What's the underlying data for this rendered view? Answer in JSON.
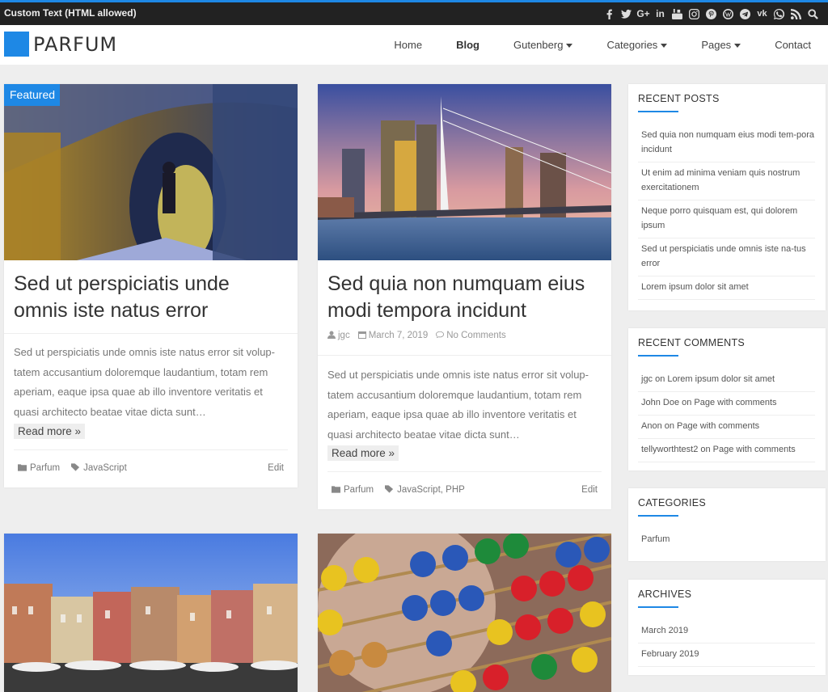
{
  "topbar": {
    "custom_text": "Custom Text (HTML allowed)",
    "social_icons": [
      "facebook-icon",
      "twitter-icon",
      "google-plus-icon",
      "linkedin-icon",
      "youtube-icon",
      "instagram-icon",
      "pinterest-icon",
      "wordpress-icon",
      "telegram-icon",
      "vk-icon",
      "whatsapp-icon",
      "rss-icon",
      "search-icon"
    ]
  },
  "header": {
    "logo_text": "PARFUM",
    "nav": [
      "Home",
      "Blog",
      "Gutenberg",
      "Categories",
      "Pages",
      "Contact"
    ]
  },
  "posts": [
    {
      "badge": "Featured",
      "title": "Sed ut perspiciatis unde omnis iste natus error",
      "excerpt": "Sed ut perspiciatis unde omnis iste natus error sit volup-tatem accusantium doloremque laudantium, totam rem aperiam, eaque ipsa quae ab illo inventore veritatis et quasi architecto beatae vitae dicta sunt…",
      "read_more": "Read more »",
      "category": "Parfum",
      "tags": "JavaScript",
      "edit": "Edit"
    },
    {
      "title": "Sed quia non numquam eius modi tempora incidunt",
      "author": "jgc",
      "date": "March 7, 2019",
      "comments": "No Comments",
      "excerpt": "Sed ut perspiciatis unde omnis iste natus error sit volup-tatem accusantium doloremque laudantium, totam rem aperiam, eaque ipsa quae ab illo inventore veritatis et quasi architecto beatae vitae dicta sunt…",
      "read_more": "Read more »",
      "category": "Parfum",
      "tags": "JavaScript, PHP",
      "edit": "Edit"
    }
  ],
  "sidebar": {
    "recent_posts": {
      "title": "RECENT POSTS",
      "items": [
        "Sed quia non numquam eius modi tem-pora incidunt",
        "Ut enim ad minima veniam quis nostrum exercitationem",
        "Neque porro quisquam est, qui dolorem ipsum",
        "Sed ut perspiciatis unde omnis iste na-tus error",
        "Lorem ipsum dolor sit amet"
      ]
    },
    "recent_comments": {
      "title": "RECENT COMMENTS",
      "items": [
        "jgc on Lorem ipsum dolor sit amet",
        "John Doe on Page with comments",
        "Anon on Page with comments",
        "tellyworthtest2 on Page with comments"
      ]
    },
    "categories": {
      "title": "CATEGORIES",
      "items": [
        "Parfum"
      ]
    },
    "archives": {
      "title": "ARCHIVES",
      "items": [
        "March 2019",
        "February 2019"
      ]
    }
  },
  "colors": {
    "accent": "#1e88e5",
    "topbar": "#222222",
    "page_bg": "#eeeeee"
  }
}
